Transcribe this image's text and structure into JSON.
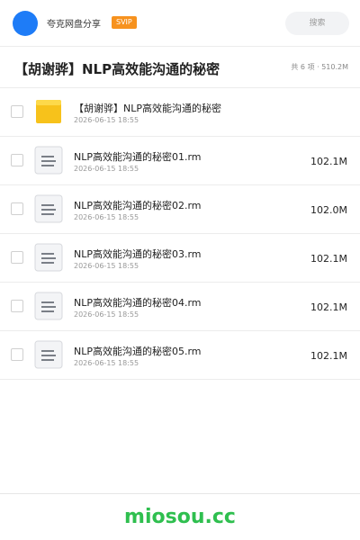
{
  "topbar": {
    "app_title": "夸克网盘分享",
    "vip_badge": "SVIP",
    "search_placeholder": "搜索",
    "avatar_color": "#1e7cf7"
  },
  "header": {
    "folder_title": "【胡谢骅】NLP高效能沟通的秘密",
    "meta": "共 6 项 · 510.2M"
  },
  "files": [
    {
      "type": "folder",
      "icon": "folder-icon",
      "name": "【胡谢骅】NLP高效能沟通的秘密",
      "date": "2026-06-15 18:55",
      "size": ""
    },
    {
      "type": "file",
      "icon": "document-icon",
      "name": "NLP高效能沟通的秘密01.rm",
      "date": "2026-06-15 18:55",
      "size": "102.1M"
    },
    {
      "type": "file",
      "icon": "document-icon",
      "name": "NLP高效能沟通的秘密02.rm",
      "date": "2026-06-15 18:55",
      "size": "102.0M"
    },
    {
      "type": "file",
      "icon": "document-icon",
      "name": "NLP高效能沟通的秘密03.rm",
      "date": "2026-06-15 18:55",
      "size": "102.1M"
    },
    {
      "type": "file",
      "icon": "document-icon",
      "name": "NLP高效能沟通的秘密04.rm",
      "date": "2026-06-15 18:55",
      "size": "102.1M"
    },
    {
      "type": "file",
      "icon": "document-icon",
      "name": "NLP高效能沟通的秘密05.rm",
      "date": "2026-06-15 18:55",
      "size": "102.1M"
    }
  ],
  "watermark": "miosou.cc"
}
